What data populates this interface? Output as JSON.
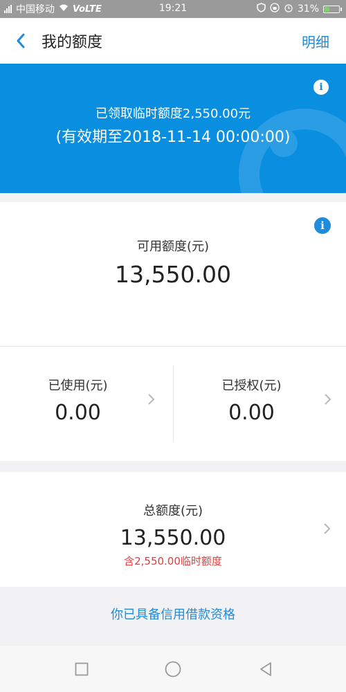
{
  "status_bar": {
    "carrier": "中国移动",
    "network": "VoLTE",
    "time": "19:21",
    "battery": "31%",
    "battery_level": 0.31
  },
  "header": {
    "title": "我的额度",
    "detail_link": "明细"
  },
  "banner": {
    "line1": "已领取临时额度2,550.00元",
    "line2": "(有效期至2018-11-14 00:00:00)",
    "info_icon": "i"
  },
  "available": {
    "label": "可用额度(元)",
    "amount": "13,550.00",
    "info_icon": "i"
  },
  "used": {
    "label": "已使用(元)",
    "amount": "0.00"
  },
  "authorized": {
    "label": "已授权(元)",
    "amount": "0.00"
  },
  "total": {
    "label": "总额度(元)",
    "amount": "13,550.00",
    "note": "含2,550.00临时额度"
  },
  "eligibility": "你已具备信用借款资格",
  "colors": {
    "accent": "#1f8bdc",
    "banner": "#0a8fe0",
    "warning_text": "#e13b3b"
  }
}
